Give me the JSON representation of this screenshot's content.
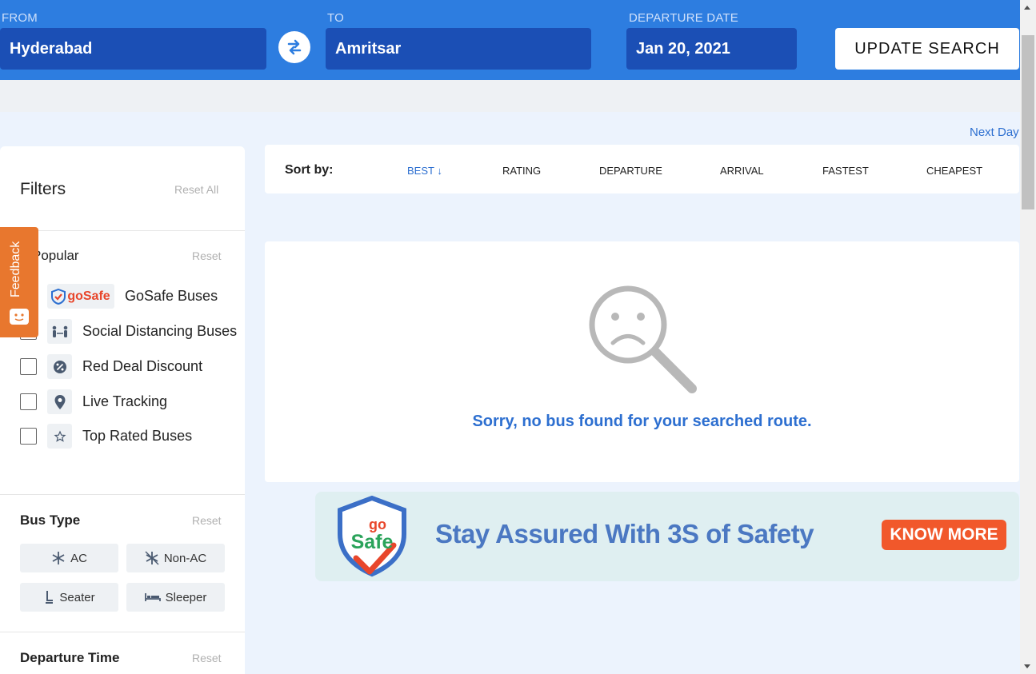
{
  "search": {
    "from_label": "FROM",
    "from_value": "Hyderabad",
    "to_label": "TO",
    "to_value": "Amritsar",
    "date_label": "DEPARTURE DATE",
    "date_value": "Jan 20, 2021",
    "update_label": "UPDATE SEARCH"
  },
  "next_day": "Next Day",
  "filters": {
    "title": "Filters",
    "reset_all": "Reset All",
    "popular": {
      "title": "Popular",
      "reset": "Reset",
      "gosafe_logo_text": "goSafe",
      "items": [
        {
          "label": "GoSafe Buses",
          "icon": "gosafe-logo"
        },
        {
          "label": "Social Distancing Buses",
          "icon": "social-distancing-icon"
        },
        {
          "label": "Red Deal Discount",
          "icon": "discount-icon"
        },
        {
          "label": "Live Tracking",
          "icon": "location-pin-icon"
        },
        {
          "label": "Top Rated Buses",
          "icon": "star-icon"
        }
      ]
    },
    "bus_type": {
      "title": "Bus Type",
      "reset": "Reset",
      "options": [
        {
          "label": "AC",
          "icon": "snowflake-icon"
        },
        {
          "label": "Non-AC",
          "icon": "no-snowflake-icon"
        },
        {
          "label": "Seater",
          "icon": "seat-icon"
        },
        {
          "label": "Sleeper",
          "icon": "bed-icon"
        }
      ]
    },
    "departure_time": {
      "title": "Departure Time",
      "reset": "Reset"
    }
  },
  "feedback": {
    "label": "Feedback"
  },
  "sort": {
    "label": "Sort by:",
    "options": [
      "BEST",
      "RATING",
      "DEPARTURE",
      "ARRIVAL",
      "FASTEST",
      "CHEAPEST"
    ],
    "active": "BEST",
    "active_indicator": "↓"
  },
  "empty_state": {
    "message": "Sorry, no bus found for your searched route.",
    "icon": "sad-magnifier-icon"
  },
  "banner": {
    "logo_top": "go",
    "logo_bottom": "Safe",
    "headline": "Stay Assured With 3S of Safety",
    "cta": "KNOW MORE"
  },
  "colors": {
    "header_blue": "#2d7de0",
    "field_blue": "#1b4fb5",
    "link_blue": "#2d6fd0",
    "feedback_orange": "#e8772e",
    "cta_orange": "#f1582b"
  }
}
